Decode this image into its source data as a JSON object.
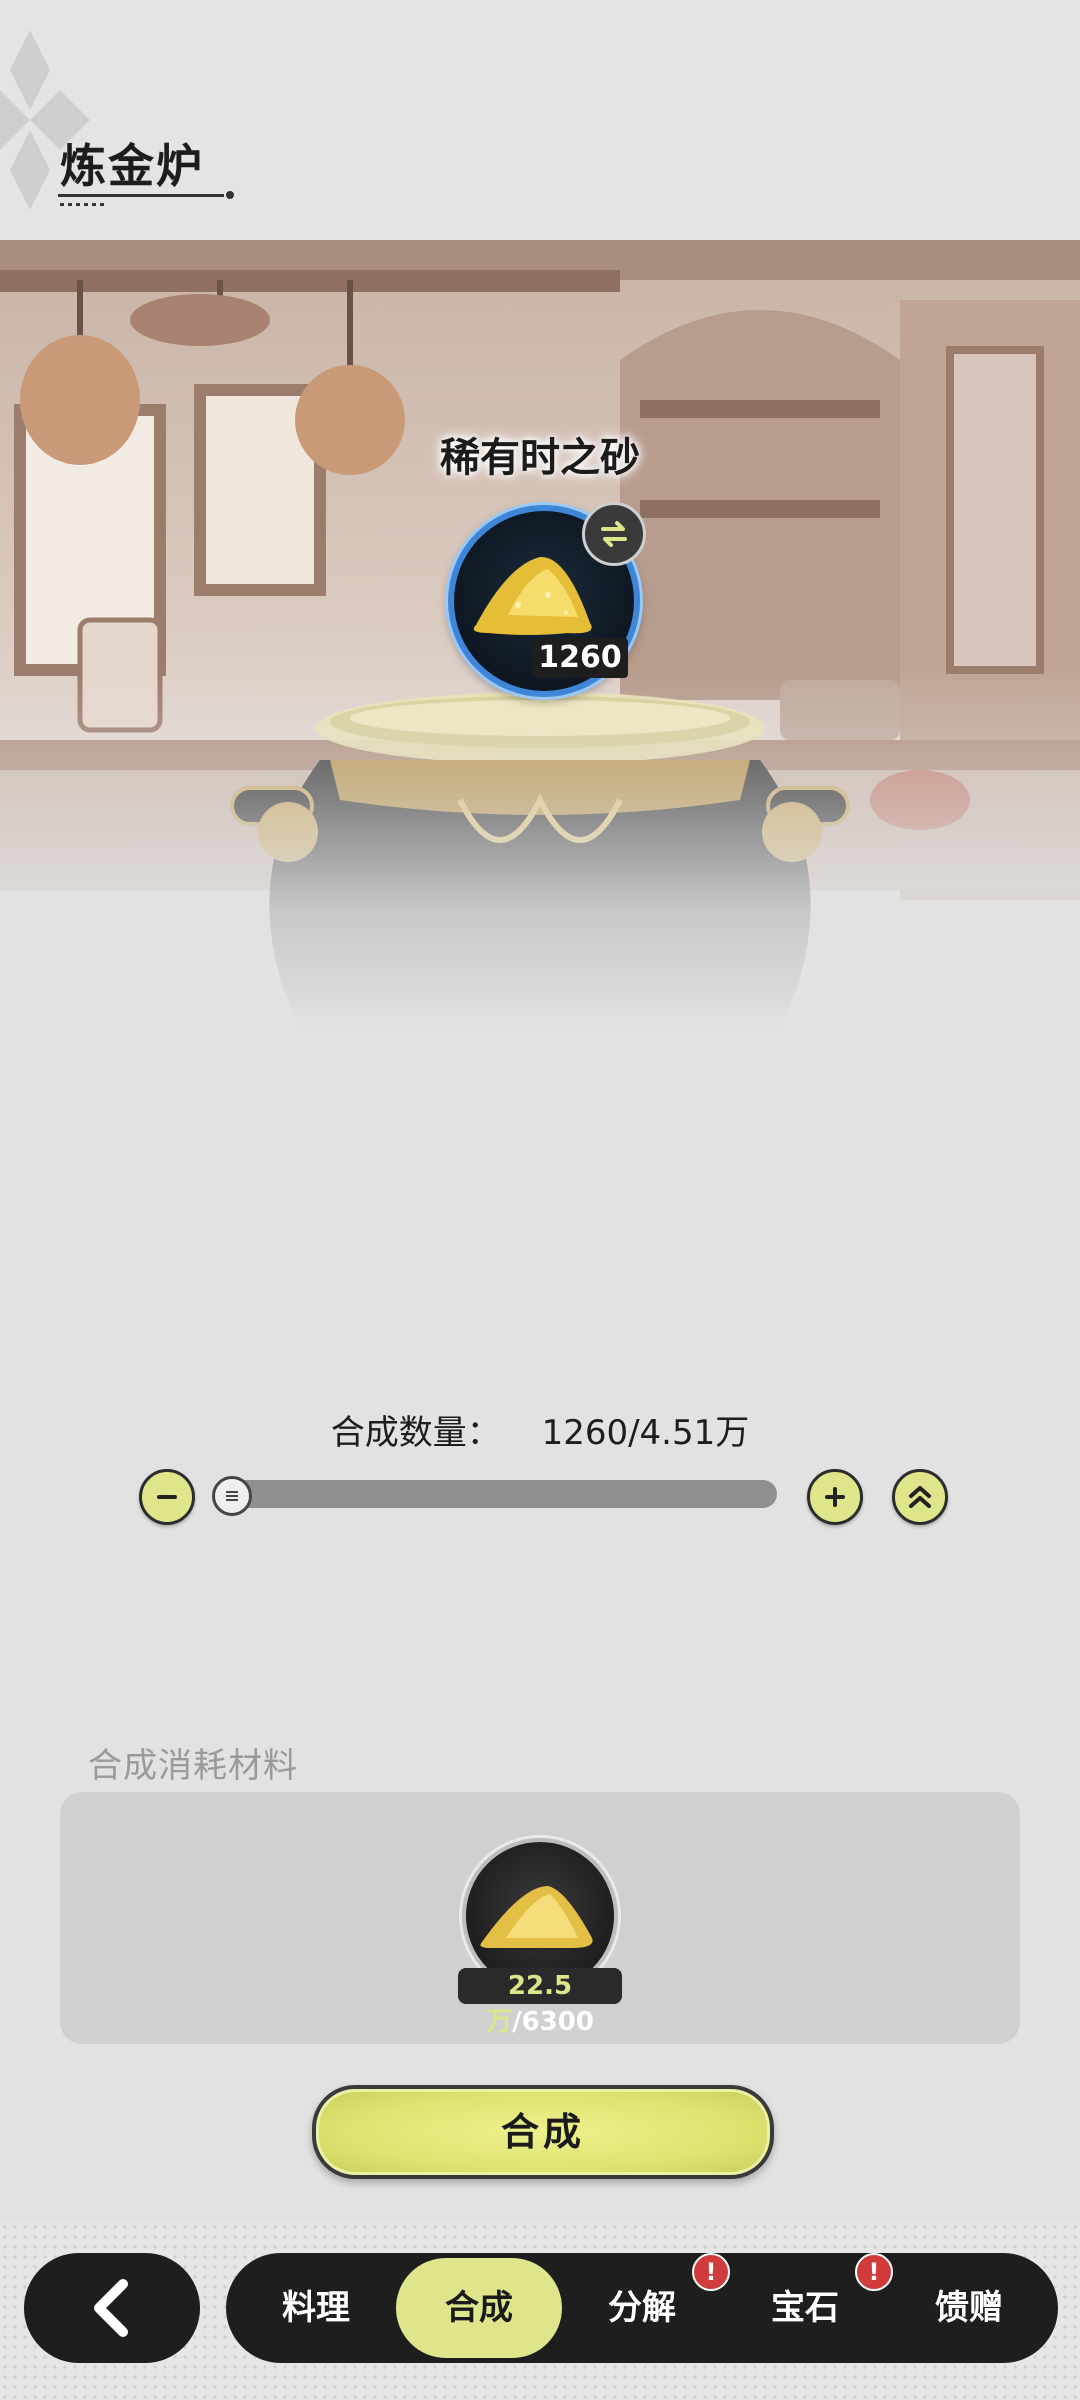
{
  "header": {
    "title": "炼金炉"
  },
  "product": {
    "name": "稀有时之砂",
    "count": "1260"
  },
  "quantity": {
    "label": "合成数量：",
    "value": "1260/4.51万"
  },
  "materials": {
    "title": "合成消耗材料",
    "items": [
      {
        "owned": "22.5万",
        "separator": "/",
        "required": "6300"
      }
    ]
  },
  "synth_button": {
    "label": "合成"
  },
  "nav": {
    "tabs": [
      {
        "label": "料理",
        "active": false,
        "badge": ""
      },
      {
        "label": "合成",
        "active": true,
        "badge": ""
      },
      {
        "label": "分解",
        "active": false,
        "badge": "!"
      },
      {
        "label": "宝石",
        "active": false,
        "badge": "!"
      },
      {
        "label": "馈赠",
        "active": false,
        "badge": ""
      }
    ]
  },
  "colors": {
    "accent": "#dfe58a",
    "dark": "#1e1e1e",
    "badge": "#d23b3b",
    "icon_ring": "#3e86d8"
  },
  "icons": [
    "swap-icon",
    "gold-sand-icon",
    "minus-icon",
    "plus-icon",
    "double-chevron-up-icon",
    "slider-grip-icon",
    "back-arrow-icon"
  ]
}
